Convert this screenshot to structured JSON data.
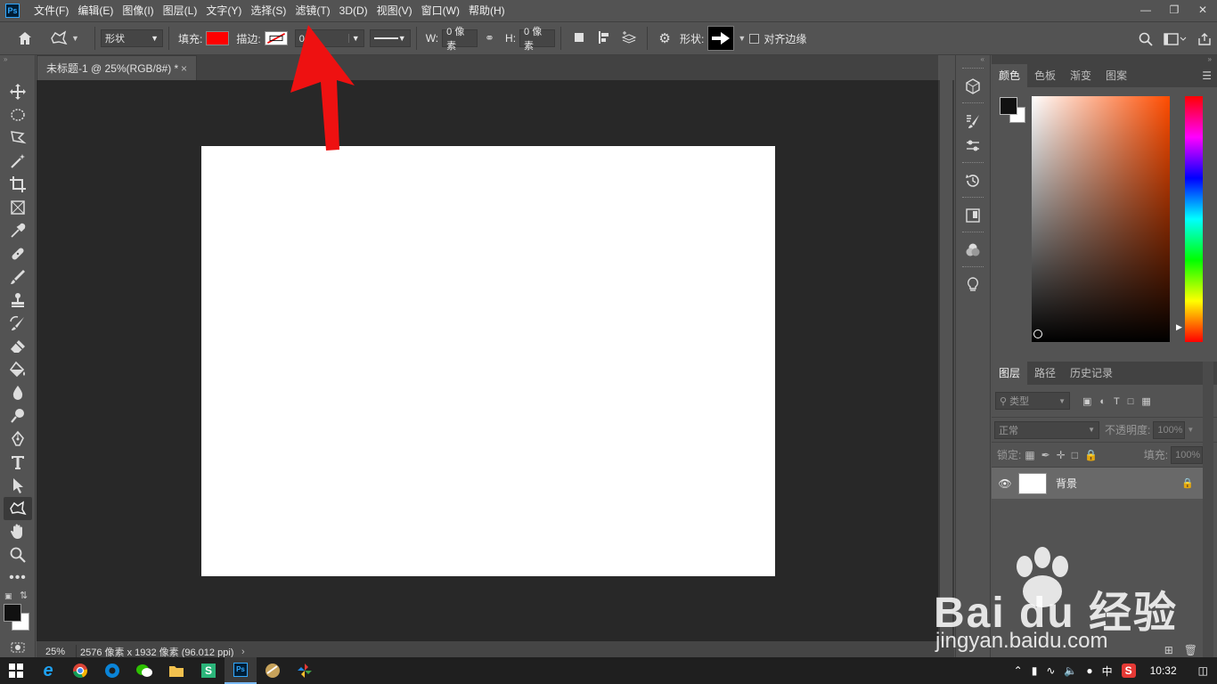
{
  "menubar": {
    "logo": "Ps",
    "items": [
      "文件(F)",
      "编辑(E)",
      "图像(I)",
      "图层(L)",
      "文字(Y)",
      "选择(S)",
      "滤镜(T)",
      "3D(D)",
      "视图(V)",
      "窗口(W)",
      "帮助(H)"
    ]
  },
  "options": {
    "mode_value": "形状",
    "fill_label": "填充:",
    "fill_color": "#ff0000",
    "stroke_label": "描边:",
    "stroke_width_value": "0 像",
    "w_label": "W:",
    "w_value": "0 像素",
    "h_label": "H:",
    "h_value": "0 像素",
    "shape_label": "形状:",
    "align_edges_label": "对齐边缘"
  },
  "document": {
    "tab_title": "未标题-1 @ 25%(RGB/8#) *",
    "tab_close": "×"
  },
  "status": {
    "zoom": "25%",
    "doc_info": "2576 像素 x 1932 像素 (96.012 ppi)"
  },
  "color_panel": {
    "tabs": [
      "颜色",
      "色板",
      "渐变",
      "图案"
    ],
    "foreground": "#111111",
    "background": "#ffffff",
    "hue": "#ff4c00"
  },
  "layers_panel": {
    "tabs": [
      "图层",
      "路径",
      "历史记录"
    ],
    "filter_placeholder": "类型",
    "blend_mode": "正常",
    "opacity_label": "不透明度:",
    "opacity_value": "100%",
    "lock_label": "锁定:",
    "fill_label": "填充:",
    "fill_value": "100%",
    "layers": [
      {
        "name": "背景",
        "visible": true,
        "locked": true
      }
    ]
  },
  "taskbar": {
    "time": "10:32",
    "ime": "中"
  },
  "watermark": {
    "brand": "Bai du 经验",
    "url": "jingyan.baidu.com"
  }
}
